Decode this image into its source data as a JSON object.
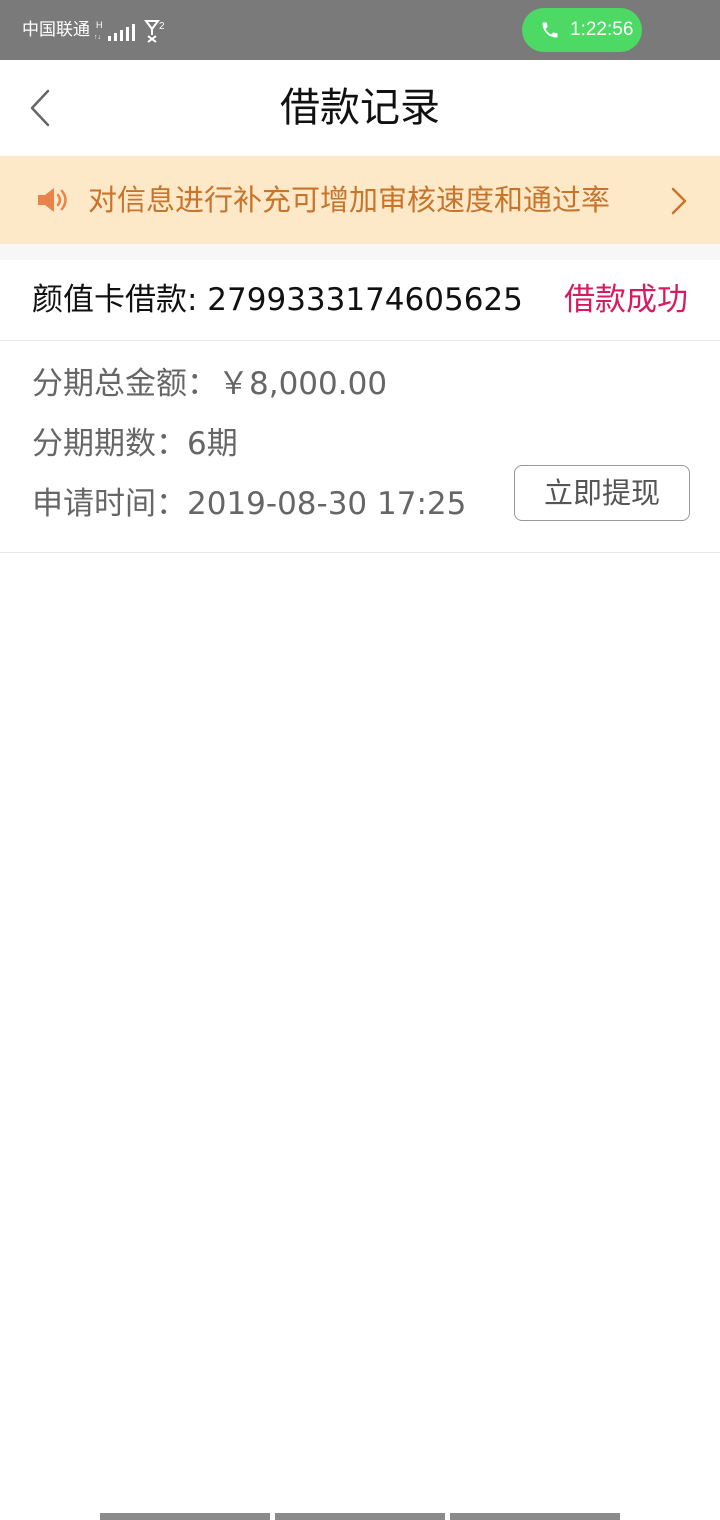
{
  "status_bar": {
    "carrier": "中国联通",
    "network_type": "H",
    "signal_icon": "signal-bars-icon",
    "wifi_call_icon": "wifi-calling-icon",
    "wifi_call_badge": "2",
    "call_time": "1:22:56",
    "call_pill_color": "#4cd964"
  },
  "nav": {
    "back_icon": "chevron-left-icon",
    "title": "借款记录"
  },
  "notice": {
    "icon": "speaker-icon",
    "text": "对信息进行补充可增加审核速度和通过率",
    "chevron_icon": "chevron-right-icon",
    "background": "#fde9c8",
    "text_color": "#c8742a"
  },
  "record": {
    "title": "颜值卡借款: 2799333174605625",
    "status": "借款成功",
    "status_color": "#d81b60",
    "amount_line": "分期总金额：￥8,000.00",
    "periods_line": "分期期数：6期",
    "apply_time_line": "申请时间：2019-08-30 17:25",
    "withdraw_label": "立即提现"
  }
}
